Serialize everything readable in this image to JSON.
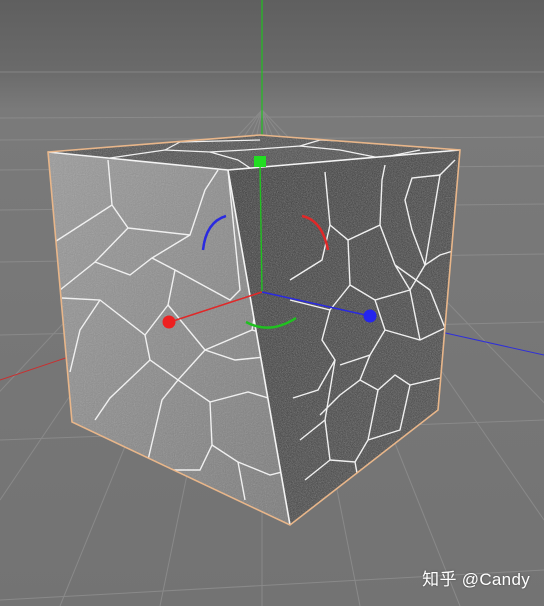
{
  "viewport": {
    "scene_object": "cube",
    "axis_colors": {
      "x": "#e02828",
      "y": "#20c020",
      "z": "#2a2ae0"
    },
    "selection_outline_color": "#e8b68a",
    "face_colors": {
      "top": "#4a4a4a",
      "left": "#8a8a8a",
      "right": "#3e3e3e"
    },
    "edge_line_color": "#f2f2f2"
  },
  "watermark": {
    "text": "知乎 @Candy"
  }
}
